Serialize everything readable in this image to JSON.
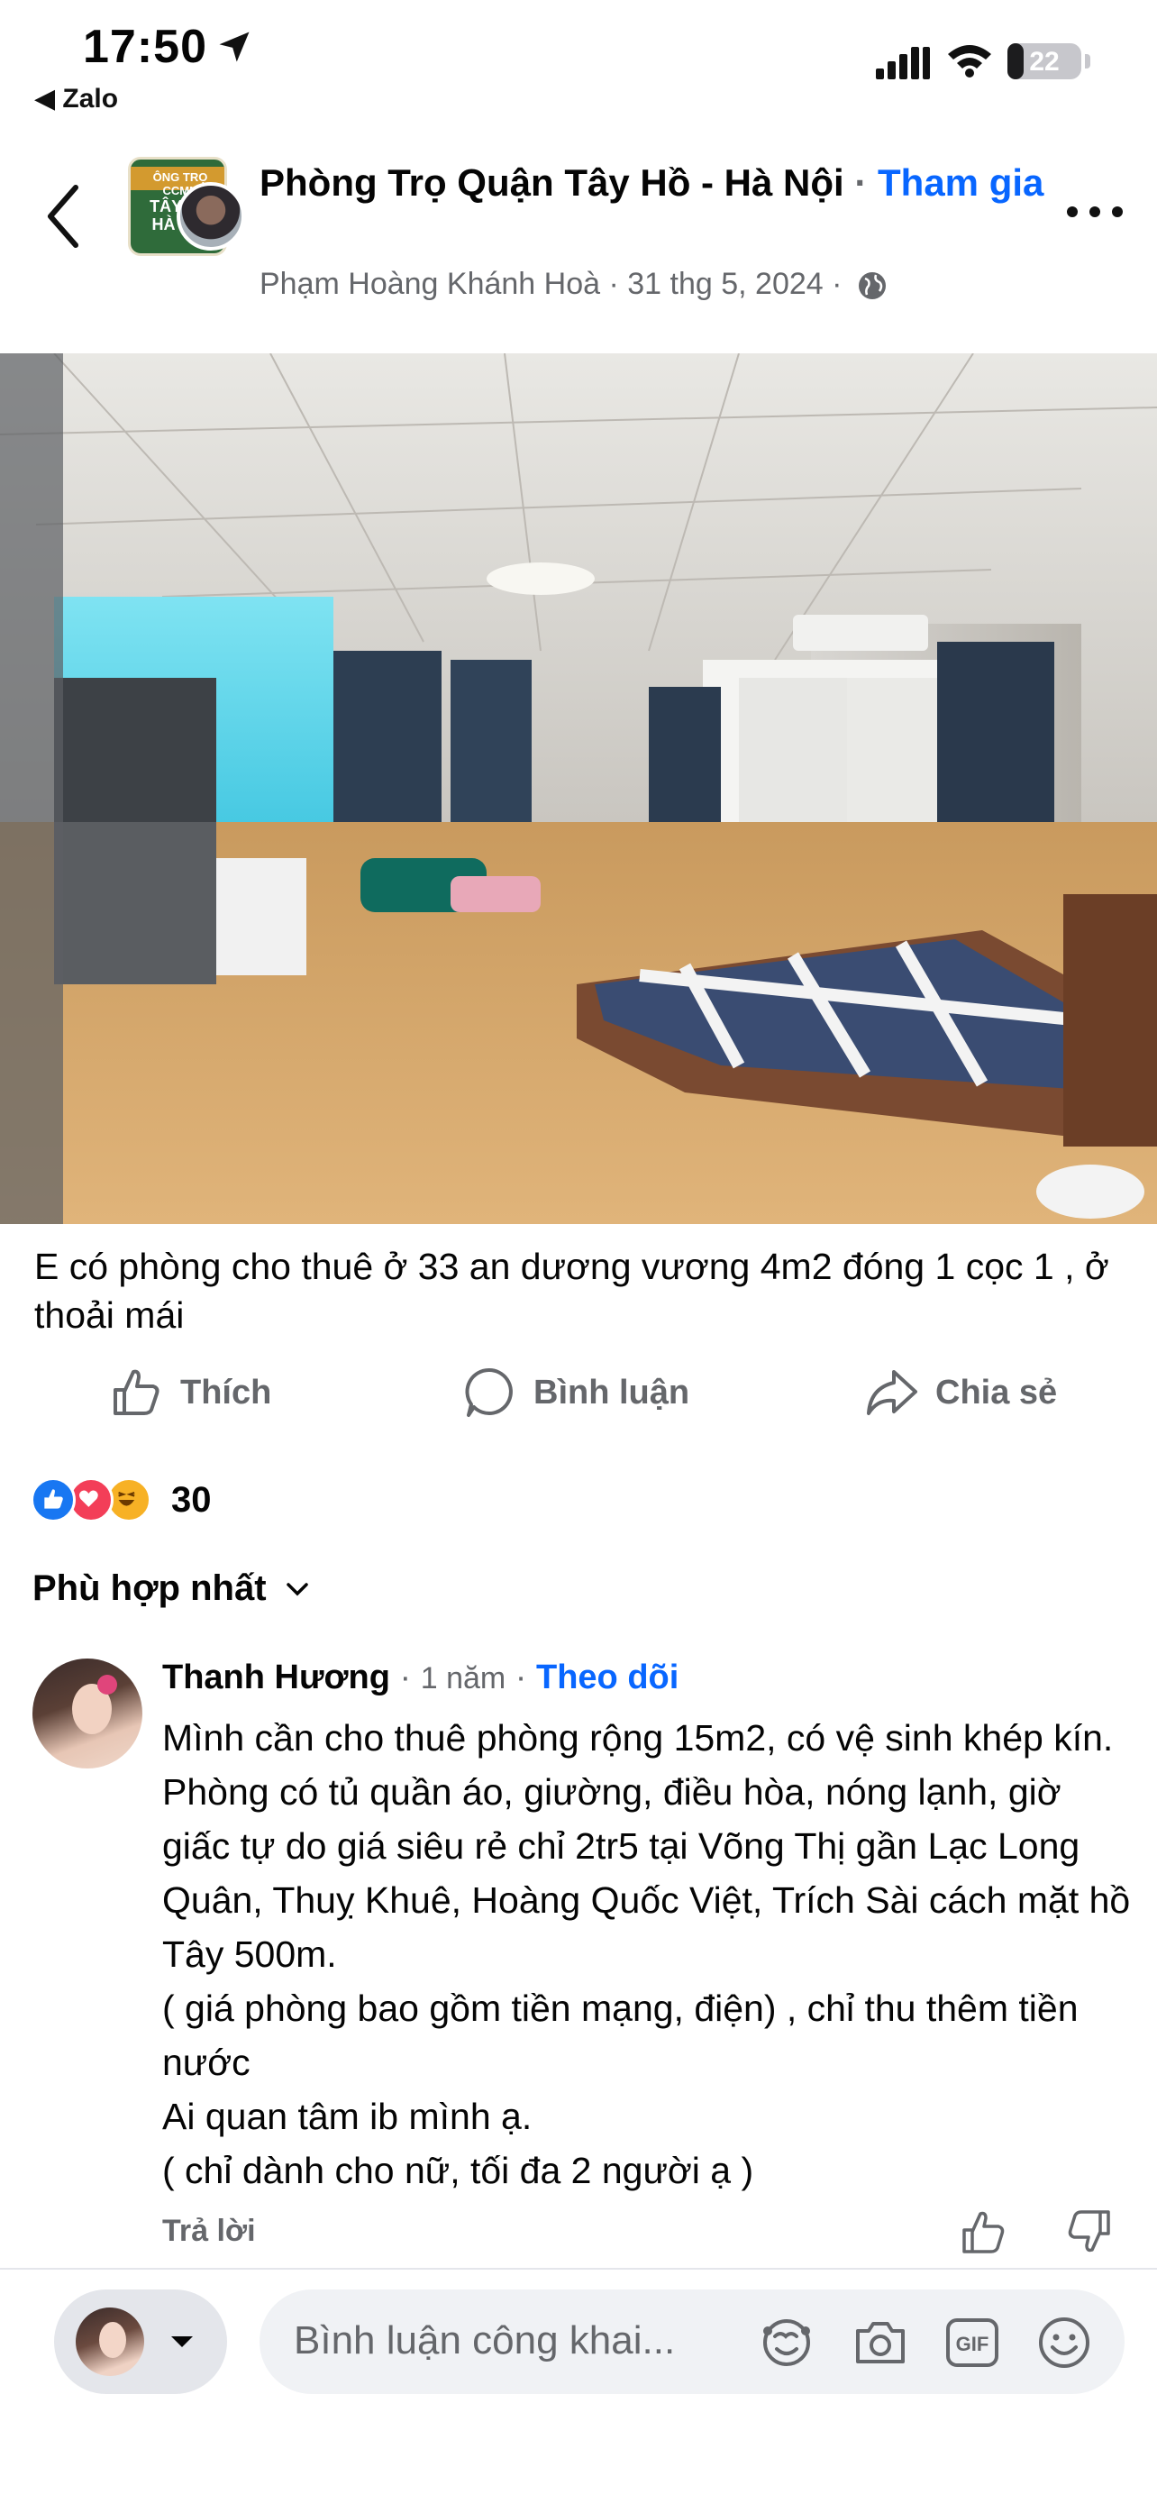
{
  "status_bar": {
    "time": "17:50",
    "back_app": "◀ Zalo",
    "battery": "22",
    "battery_level_percent": 22
  },
  "header": {
    "group_name": "Phòng Trọ Quận Tây Hồ - Hà Nội",
    "separator": " · ",
    "join_label": "Tham gia",
    "author": "Phạm Hoàng Khánh Hoà",
    "meta_separator": " · ",
    "date": "31 thg 5, 2024",
    "meta_separator_2": " · ",
    "group_avatar_line1": "ÔNG TRỌ CCMN",
    "group_avatar_line2": "TÂY HỒ HÀ NỘI"
  },
  "post": {
    "text": "E có phòng cho thuê ở 33 an dương vương 4m2 đóng 1 cọc 1 , ở thoải mái"
  },
  "actions": {
    "like": "Thích",
    "comment": "Bình luận",
    "share": "Chia sẻ"
  },
  "reactions": {
    "count": "30",
    "types": [
      "like-icon",
      "love-icon",
      "haha-icon"
    ]
  },
  "sort": {
    "label": "Phù hợp nhất"
  },
  "comment": {
    "name": "Thanh Hương",
    "separator": " · ",
    "time": "1 năm",
    "separator2": " · ",
    "follow": "Theo dõi",
    "body": "Mình cần cho thuê phòng rộng 15m2, có vệ sinh khép kín. Phòng có tủ quần áo, giường, điều hòa, nóng lạnh, giờ giấc tự do giá siêu rẻ chỉ 2tr5 tại Võng Thị gần Lạc Long Quân, Thuỵ Khuê, Hoàng Quốc Việt, Trích Sài cách mặt hồ Tây 500m.\n( giá phòng bao gồm tiền mạng, điện) , chỉ thu thêm tiền nước\nAi quan tâm ib mình ạ.\n( chỉ dành cho nữ, tối đa 2 người ạ )",
    "reply": "Trả lời"
  },
  "composer": {
    "placeholder": "Bình luận công khai...",
    "gif_label": "GIF"
  },
  "colors": {
    "accent": "#0866ff",
    "secondary_text": "#65676b",
    "like_blue": "#1877f2",
    "love_red": "#f33e58",
    "haha_yellow": "#f7b125"
  }
}
